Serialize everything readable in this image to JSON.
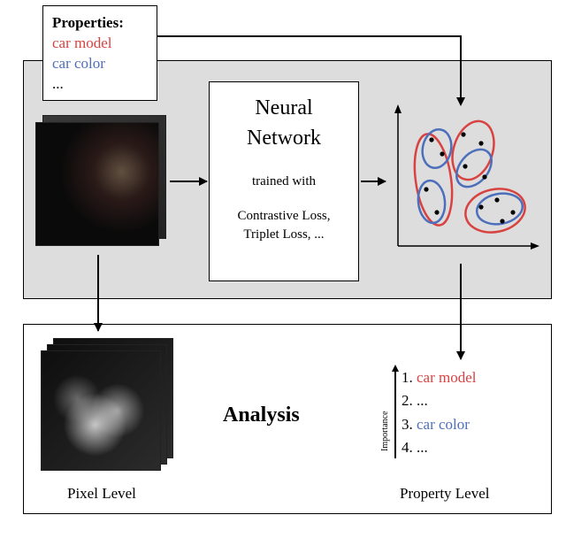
{
  "properties_panel": {
    "title": "Properties:",
    "items": [
      "car model",
      "car color",
      "..."
    ],
    "colors": [
      "#d84240",
      "#4d6fbb",
      "#000000"
    ]
  },
  "nn_box": {
    "line1": "Neural",
    "line2": "Network",
    "trained": "trained with",
    "losses_l1": "Contrastive Loss,",
    "losses_l2": "Triplet Loss, ..."
  },
  "analysis": {
    "title": "Analysis",
    "importance_label": "Importance",
    "ranking": [
      {
        "n": "1.",
        "text": "car model",
        "cls": "red"
      },
      {
        "n": "2.",
        "text": "...",
        "cls": ""
      },
      {
        "n": "3.",
        "text": "car color",
        "cls": "blue"
      },
      {
        "n": "4.",
        "text": "...",
        "cls": ""
      }
    ]
  },
  "captions": {
    "pixel": "Pixel Level",
    "property": "Property Level"
  },
  "embedding_plot": {
    "red_clusters": 3,
    "blue_clusters": 4,
    "points": 12
  },
  "colors": {
    "red": "#d84240",
    "blue": "#4d6fbb"
  }
}
